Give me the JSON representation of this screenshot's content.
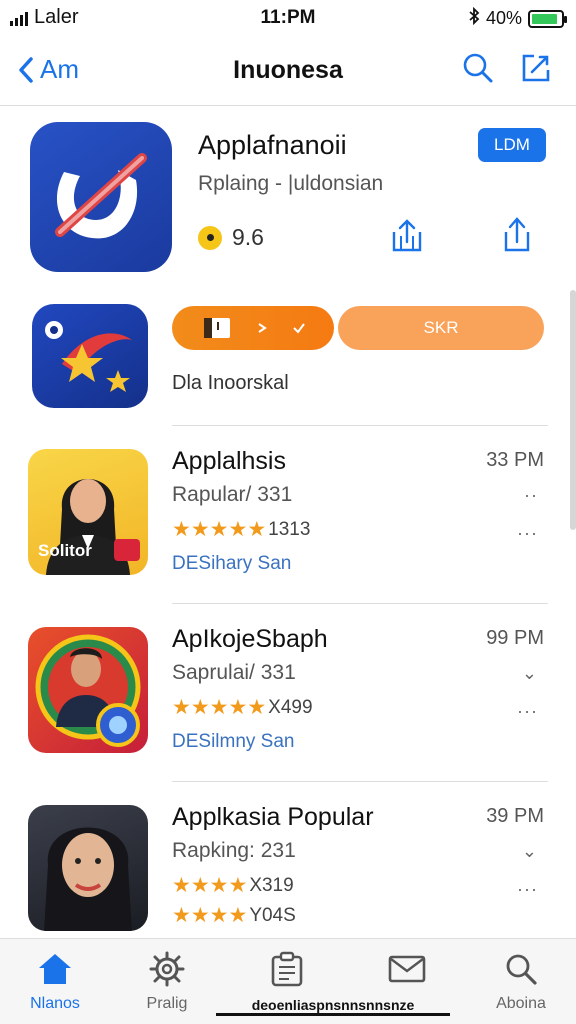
{
  "status_bar": {
    "carrier": "Laler",
    "time": "11:PM",
    "battery": "40%",
    "battery_level": 0.9
  },
  "nav": {
    "back_label": "Am",
    "title": "Inuonesa"
  },
  "featured": {
    "name": "Applafnanoii",
    "subtitle": "Rplaing - |uldonsian",
    "rating": "9.6",
    "get_label": "LDM"
  },
  "promo": {
    "pill_b_label": "SKR",
    "label": "Dla Inoorskal"
  },
  "list": [
    {
      "title": "Applalhsis",
      "subtitle": "Rapular/ 331",
      "stars": "★★★★",
      "rating_count": "1313",
      "tag": "DESihary San",
      "time": "33 PM",
      "thumb_label": "Solitor"
    },
    {
      "title": "ApIkojeSbaph",
      "subtitle": "Saprulai/ 331",
      "stars": "★★★★",
      "rating_count": "X499",
      "tag": "DESilmny San",
      "time": "99 PM"
    },
    {
      "title": "Applkasia Popular",
      "subtitle": "Rapking: 231",
      "stars": "★★★★",
      "rating_count": "X319",
      "tag": "",
      "time": "39 PM"
    }
  ],
  "list3_extra": {
    "stars": "★★★★",
    "rating_count": "Y04S"
  },
  "tabs": [
    {
      "label": "Nlanos",
      "icon": "home-icon"
    },
    {
      "label": "Pralig",
      "icon": "gear-icon"
    },
    {
      "label": "",
      "icon": "clipboard-icon"
    },
    {
      "label": "",
      "icon": "mail-icon"
    },
    {
      "label": "Aboina",
      "icon": "search-icon"
    }
  ],
  "tab_legend": "deoenliaspnsnnsnnsnze",
  "colors": {
    "accent": "#1a73e8",
    "star": "#f29a1c",
    "orange": "#f57a12",
    "battery": "#34c759"
  }
}
